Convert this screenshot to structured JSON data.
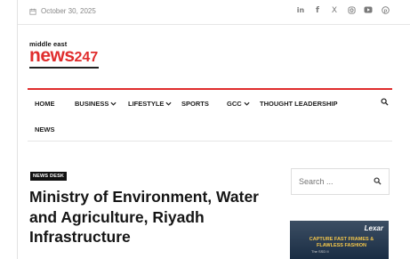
{
  "topbar": {
    "date": "October 30, 2025",
    "social": [
      "linkedin-icon",
      "facebook-icon",
      "x-icon",
      "instagram-icon",
      "youtube-icon",
      "pinterest-icon"
    ]
  },
  "logo": {
    "top": "middle east",
    "main": "news",
    "number": "247"
  },
  "nav": {
    "items": [
      {
        "label": "HOME"
      },
      {
        "label": "BUSINESS"
      },
      {
        "label": "LIFESTYLE"
      },
      {
        "label": "SPORTS"
      },
      {
        "label": "GCC"
      },
      {
        "label": "THOUGHT LEADERSHIP"
      },
      {
        "label": "NEWS"
      }
    ]
  },
  "article": {
    "badge": "NEWS DESK",
    "headline": "Ministry of Environment, Water and Agriculture, Riyadh Infrastructure"
  },
  "sidebar": {
    "search_placeholder": "Search ...",
    "ad": {
      "brand": "Lexar",
      "text": "CAPTURE FAST FRAMES & FLAWLESS FASHION",
      "sub": "The SSD II"
    }
  },
  "colors": {
    "accent": "#e02d2d",
    "text": "#151515"
  }
}
